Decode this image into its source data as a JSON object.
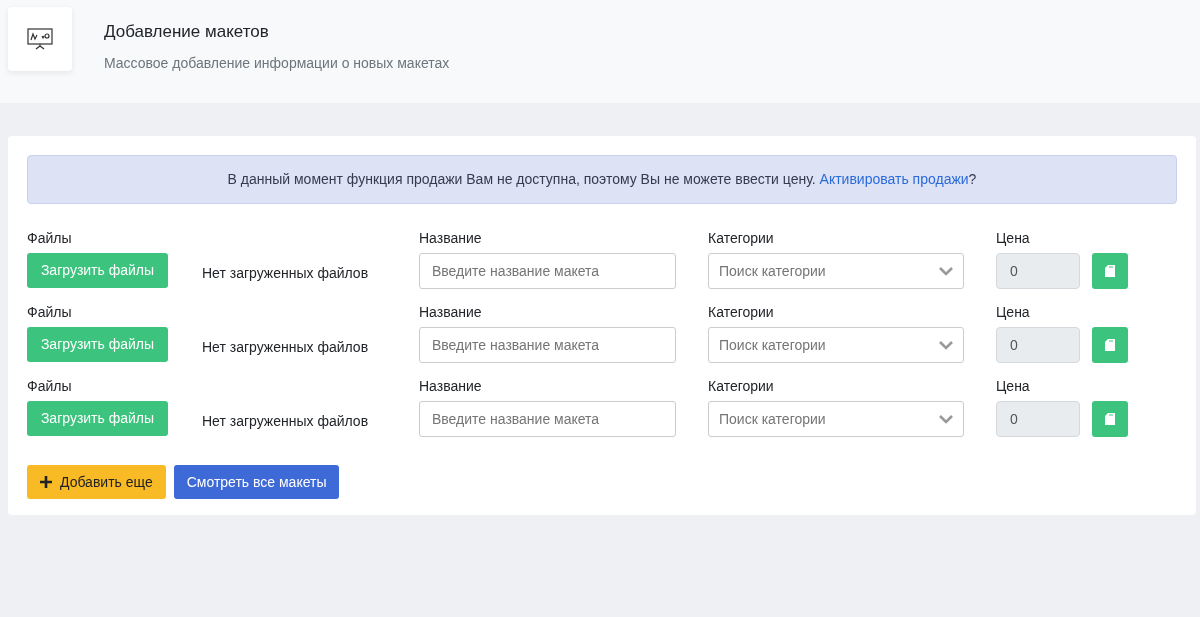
{
  "header": {
    "title": "Добавление макетов",
    "subtitle": "Массовое добавление информации о новых макетах"
  },
  "alert": {
    "text": "В данный момент функция продажи Вам не доступна, поэтому Вы не можете ввести цену. ",
    "link": "Активировать продажи",
    "suffix": "?"
  },
  "rows": [
    {
      "files_label": "Файлы",
      "upload_button": "Загрузить файлы",
      "files_status": "Нет загруженных файлов",
      "name_label": "Название",
      "name_placeholder": "Введите название макета",
      "category_label": "Категории",
      "category_placeholder": "Поиск категории",
      "price_label": "Цена",
      "price_value": "0",
      "price_disabled": true
    },
    {
      "files_label": "Файлы",
      "upload_button": "Загрузить файлы",
      "files_status": "Нет загруженных файлов",
      "name_label": "Название",
      "name_placeholder": "Введите название макета",
      "category_label": "Категории",
      "category_placeholder": "Поиск категории",
      "price_label": "Цена",
      "price_value": "0",
      "price_disabled": true
    },
    {
      "files_label": "Файлы",
      "upload_button": "Загрузить файлы",
      "files_status": "Нет загруженных файлов",
      "name_label": "Название",
      "name_placeholder": "Введите название макета",
      "category_label": "Категории",
      "category_placeholder": "Поиск категории",
      "price_label": "Цена",
      "price_value": "0",
      "price_disabled": true
    }
  ],
  "actions": [
    {
      "kind": "add",
      "label": "Добавить еще"
    },
    {
      "kind": "view",
      "label": "Смотреть все макеты"
    }
  ]
}
